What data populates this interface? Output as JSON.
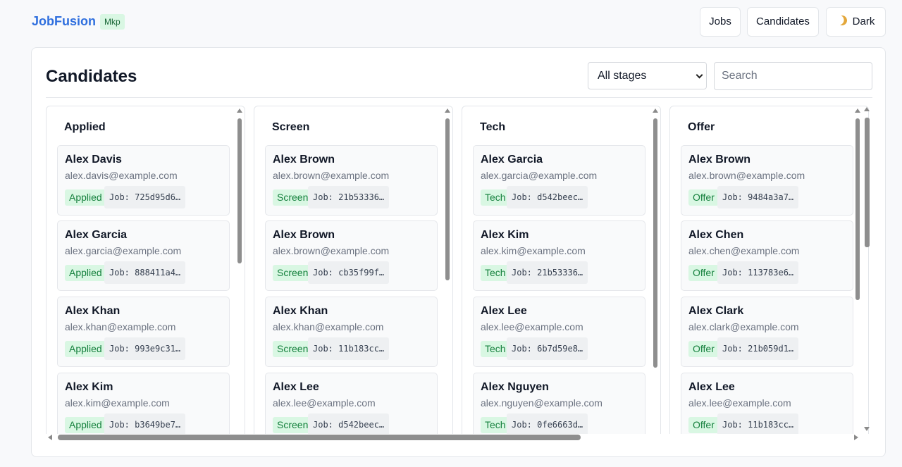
{
  "header": {
    "brand": "JobFusion",
    "brand_badge": "Mkp",
    "nav": {
      "jobs": "Jobs",
      "candidates": "Candidates",
      "dark": "Dark"
    },
    "dark_icon": "moon-icon"
  },
  "page": {
    "title": "Candidates",
    "stage_filter": {
      "selected": "All stages"
    },
    "search": {
      "placeholder": "Search",
      "value": ""
    }
  },
  "colors": {
    "brand": "#2f6fde",
    "badge_bg": "#d9f7e3",
    "badge_text": "#15803d"
  },
  "columns": [
    {
      "title": "Applied",
      "cards": [
        {
          "name": "Alex Davis",
          "email": "alex.davis@example.com",
          "stage": "Applied",
          "job": "Job: 725d95d6…"
        },
        {
          "name": "Alex Garcia",
          "email": "alex.garcia@example.com",
          "stage": "Applied",
          "job": "Job: 888411a4…"
        },
        {
          "name": "Alex Khan",
          "email": "alex.khan@example.com",
          "stage": "Applied",
          "job": "Job: 993e9c31…"
        },
        {
          "name": "Alex Kim",
          "email": "alex.kim@example.com",
          "stage": "Applied",
          "job": "Job: b3649be7…"
        }
      ]
    },
    {
      "title": "Screen",
      "cards": [
        {
          "name": "Alex Brown",
          "email": "alex.brown@example.com",
          "stage": "Screen",
          "job": "Job: 21b53336…"
        },
        {
          "name": "Alex Brown",
          "email": "alex.brown@example.com",
          "stage": "Screen",
          "job": "Job: cb35f99f…"
        },
        {
          "name": "Alex Khan",
          "email": "alex.khan@example.com",
          "stage": "Screen",
          "job": "Job: 11b183cc…"
        },
        {
          "name": "Alex Lee",
          "email": "alex.lee@example.com",
          "stage": "Screen",
          "job": "Job: d542beec…"
        }
      ]
    },
    {
      "title": "Tech",
      "cards": [
        {
          "name": "Alex Garcia",
          "email": "alex.garcia@example.com",
          "stage": "Tech",
          "job": "Job: d542beec…"
        },
        {
          "name": "Alex Kim",
          "email": "alex.kim@example.com",
          "stage": "Tech",
          "job": "Job: 21b53336…"
        },
        {
          "name": "Alex Lee",
          "email": "alex.lee@example.com",
          "stage": "Tech",
          "job": "Job: 6b7d59e8…"
        },
        {
          "name": "Alex Nguyen",
          "email": "alex.nguyen@example.com",
          "stage": "Tech",
          "job": "Job: 0fe6663d…"
        }
      ]
    },
    {
      "title": "Offer",
      "cards": [
        {
          "name": "Alex Brown",
          "email": "alex.brown@example.com",
          "stage": "Offer",
          "job": "Job: 9484a3a7…"
        },
        {
          "name": "Alex Chen",
          "email": "alex.chen@example.com",
          "stage": "Offer",
          "job": "Job: 113783e6…"
        },
        {
          "name": "Alex Clark",
          "email": "alex.clark@example.com",
          "stage": "Offer",
          "job": "Job: 21b059d1…"
        },
        {
          "name": "Alex Lee",
          "email": "alex.lee@example.com",
          "stage": "Offer",
          "job": "Job: 11b183cc…"
        }
      ]
    }
  ]
}
